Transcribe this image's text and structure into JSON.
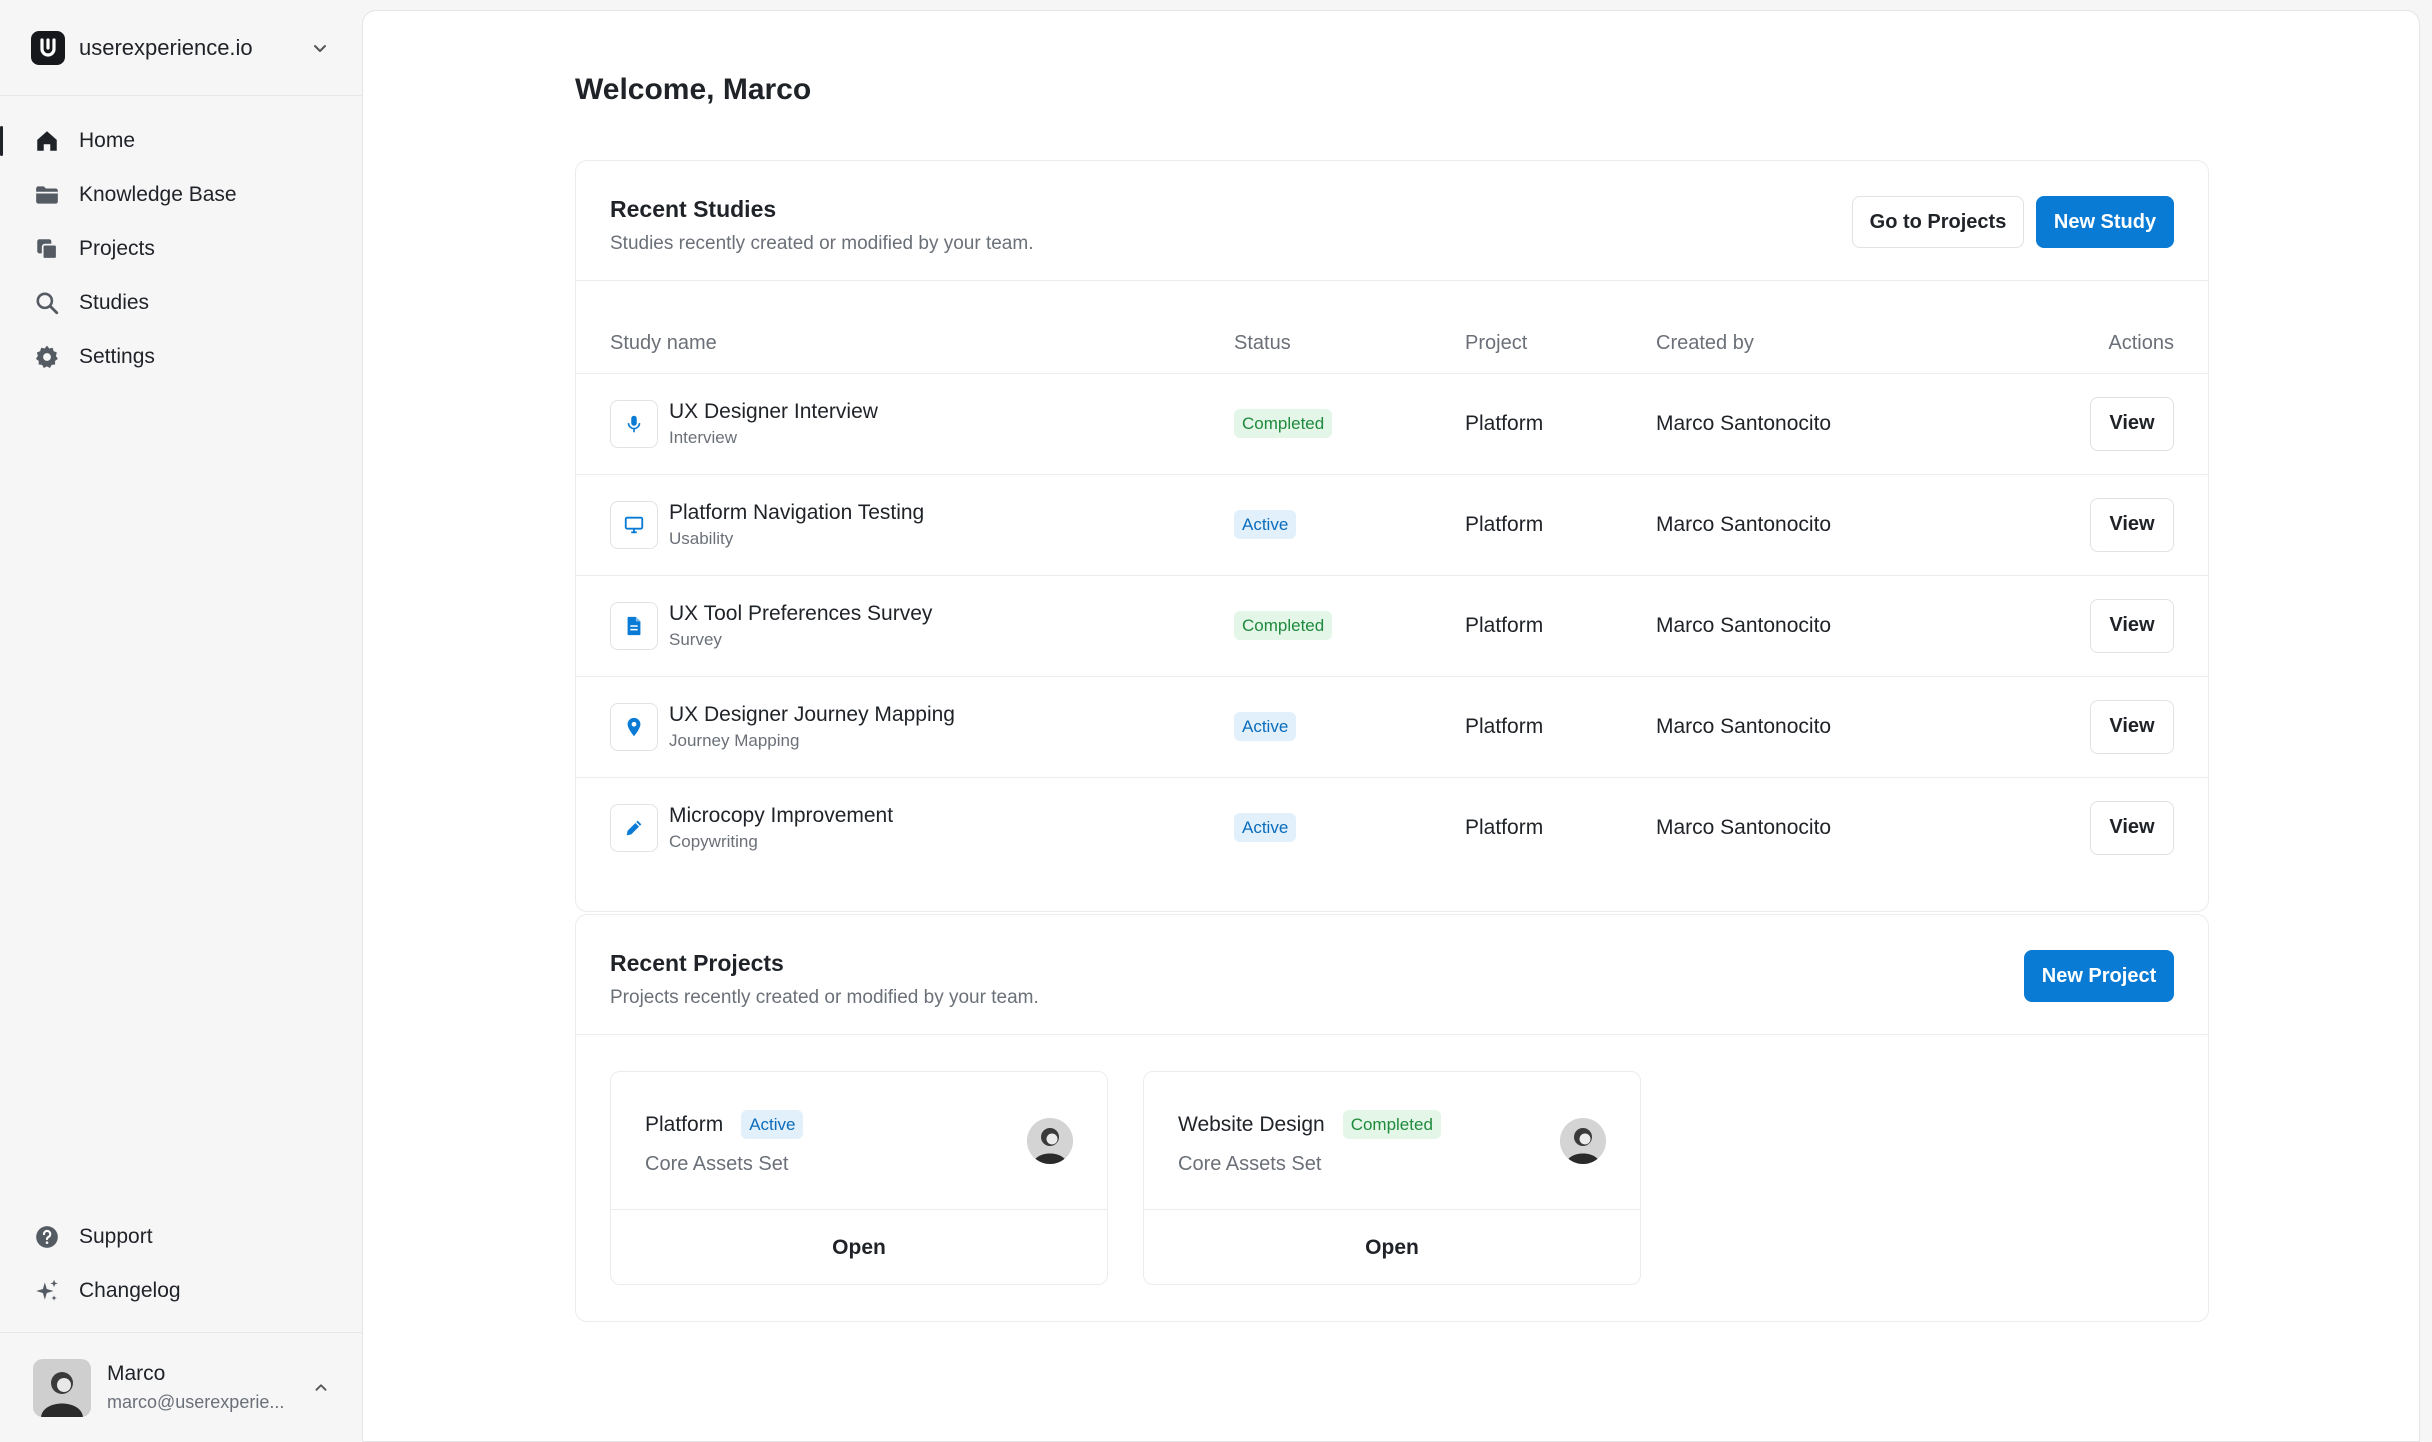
{
  "workspace": {
    "name": "userexperience.io"
  },
  "nav": {
    "items": [
      {
        "label": "Home",
        "icon": "home-icon"
      },
      {
        "label": "Knowledge Base",
        "icon": "folder-icon"
      },
      {
        "label": "Projects",
        "icon": "copy-icon"
      },
      {
        "label": "Studies",
        "icon": "search-icon"
      },
      {
        "label": "Settings",
        "icon": "gear-icon"
      }
    ],
    "bottom": [
      {
        "label": "Support",
        "icon": "help-icon"
      },
      {
        "label": "Changelog",
        "icon": "sparkle-icon"
      }
    ]
  },
  "user": {
    "name": "Marco",
    "email": "marco@userexperie..."
  },
  "welcome": "Welcome, Marco",
  "studies": {
    "title": "Recent Studies",
    "subtitle": "Studies recently created or modified by your team.",
    "go_projects": "Go to Projects",
    "new_study": "New Study",
    "columns": [
      "Study name",
      "Status",
      "Project",
      "Created by",
      "Actions"
    ],
    "rows": [
      {
        "name": "UX Designer Interview",
        "type": "Interview",
        "status": "Completed",
        "project": "Platform",
        "created_by": "Marco Santonocito",
        "action": "View",
        "icon": "microphone-icon"
      },
      {
        "name": "Platform Navigation Testing",
        "type": "Usability",
        "status": "Active",
        "project": "Platform",
        "created_by": "Marco Santonocito",
        "action": "View",
        "icon": "monitor-icon"
      },
      {
        "name": "UX Tool Preferences Survey",
        "type": "Survey",
        "status": "Completed",
        "project": "Platform",
        "created_by": "Marco Santonocito",
        "action": "View",
        "icon": "document-icon"
      },
      {
        "name": "UX Designer Journey Mapping",
        "type": "Journey Mapping",
        "status": "Active",
        "project": "Platform",
        "created_by": "Marco Santonocito",
        "action": "View",
        "icon": "map-pin-icon"
      },
      {
        "name": "Microcopy Improvement",
        "type": "Copywriting",
        "status": "Active",
        "project": "Platform",
        "created_by": "Marco Santonocito",
        "action": "View",
        "icon": "pencil-icon"
      }
    ]
  },
  "projects": {
    "title": "Recent Projects",
    "subtitle": "Projects recently created or modified by your team.",
    "new_project": "New Project",
    "items": [
      {
        "name": "Platform",
        "status": "Active",
        "subtitle": "Core Assets Set",
        "action": "Open"
      },
      {
        "name": "Website Design",
        "status": "Completed",
        "subtitle": "Core Assets Set",
        "action": "Open"
      }
    ]
  },
  "colors": {
    "accent": "#0a7bd5",
    "completed_bg": "#e3f6e8",
    "completed_text": "#1f8a3c",
    "active_bg": "#e2f0fb",
    "active_text": "#0a6cbc"
  }
}
